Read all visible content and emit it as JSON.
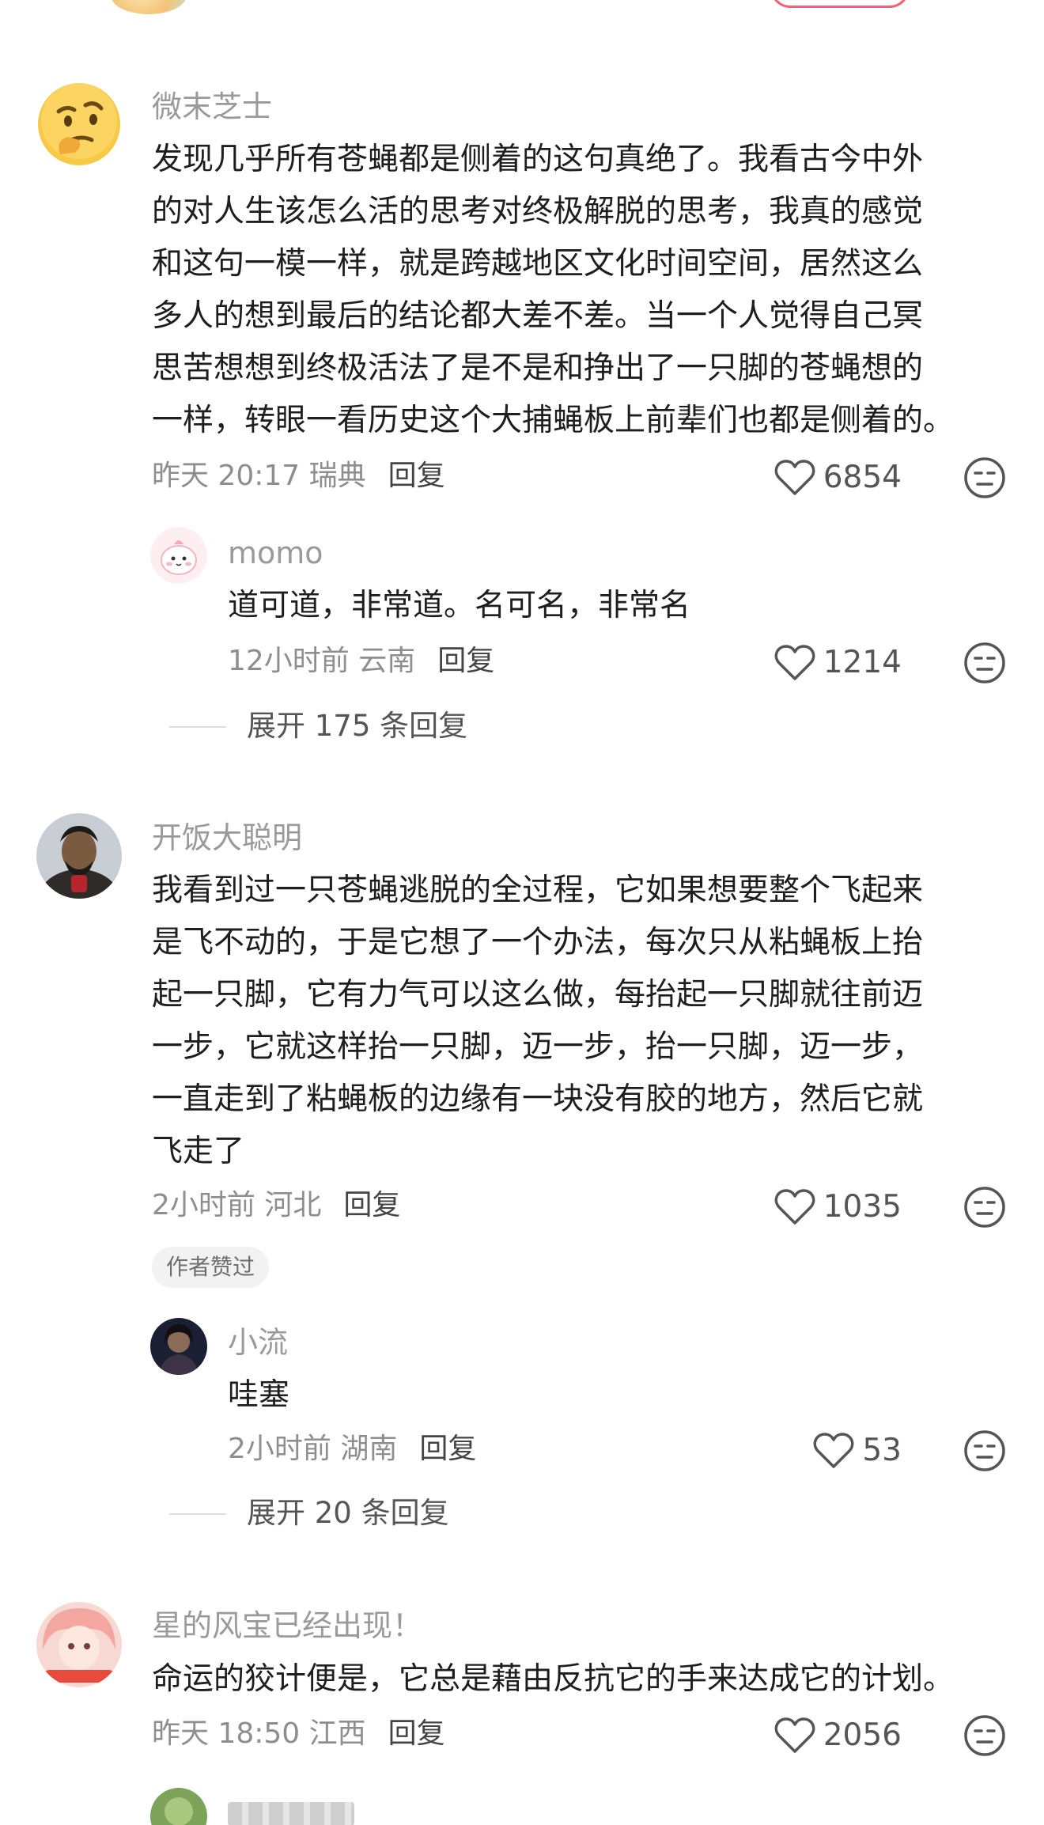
{
  "comments": [
    {
      "name": "微末芝士",
      "lines": [
        "发现几乎所有苍蝇都是侧着的这句真绝了。我看古今中外",
        "的对人生该怎么活的思考对终极解脱的思考，我真的感觉",
        "和这句一模一样，就是跨越地区文化时间空间，居然这么",
        "多人的想到最后的结论都大差不差。当一个人觉得自己冥",
        "思苦想想到终极活法了是不是和挣出了一只脚的苍蝇想的",
        "一样，转眼一看历史这个大捕蝇板上前辈们也都是侧着的。"
      ],
      "meta": "昨天 20:17 瑞典",
      "reply_label": "回复",
      "likes": "6854",
      "reply": {
        "name": "momo",
        "text": "道可道，非常道。名可名，非常名",
        "meta": "12小时前 云南",
        "reply_label": "回复",
        "likes": "1214"
      },
      "expand": "展开 175 条回复"
    },
    {
      "name": "开饭大聪明",
      "lines": [
        "我看到过一只苍蝇逃脱的全过程，它如果想要整个飞起来",
        "是飞不动的，于是它想了一个办法，每次只从粘蝇板上抬",
        "起一只脚，它有力气可以这么做，每抬起一只脚就往前迈",
        "一步，它就这样抬一只脚，迈一步，抬一只脚，迈一步，",
        "一直走到了粘蝇板的边缘有一块没有胶的地方，然后它就",
        "飞走了"
      ],
      "meta": "2小时前 河北",
      "reply_label": "回复",
      "likes": "1035",
      "badge": "作者赞过",
      "reply": {
        "name": "小流",
        "text": "哇塞",
        "meta": "2小时前 湖南",
        "reply_label": "回复",
        "likes": "53"
      },
      "expand": "展开 20 条回复"
    },
    {
      "name": "星的风宝已经出现！",
      "lines": [
        "命运的狡计便是，它总是藉由反抗它的手来达成它的计划。"
      ],
      "meta": "昨天 18:50 江西",
      "reply_label": "回复",
      "likes": "2056"
    }
  ],
  "icons": {
    "heart": "heart-outline-icon",
    "dislike": "neutral-face-icon"
  },
  "colors": {
    "accent": "#f2607a",
    "meta_gray": "#8e8e8e"
  }
}
